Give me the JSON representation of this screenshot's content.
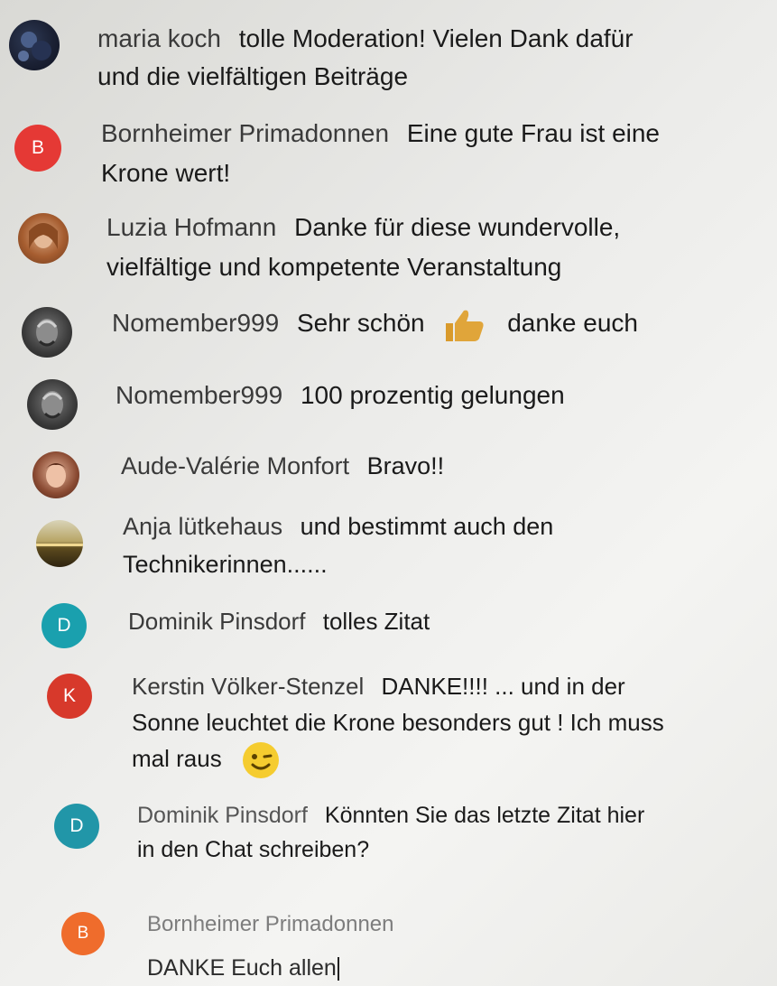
{
  "messages": [
    {
      "author": "maria koch",
      "text": "tolle Moderation! Vielen Dank dafür",
      "text2": "und die vielfältigen Beiträge",
      "avatar": "photo"
    },
    {
      "author": "Bornheimer Primadonnen",
      "text": "Eine gute Frau ist eine",
      "text2": "Krone wert!",
      "avatar_letter": "B",
      "avatar_color": "#e53935"
    },
    {
      "author": "Luzia Hofmann",
      "text": "Danke für diese wundervolle,",
      "text2": "vielfältige und kompetente Veranstaltung",
      "avatar": "photo"
    },
    {
      "author": "Nomember999",
      "text": "Sehr schön",
      "text_after": "danke euch",
      "emoji": "thumbs-up"
    },
    {
      "author": "Nomember999",
      "text": "100 prozentig gelungen"
    },
    {
      "author": "Aude-Valérie Monfort",
      "text": "Bravo!!"
    },
    {
      "author": "Anja lütkehaus",
      "text": "und bestimmt auch den",
      "text2": "Technikerinnen......"
    },
    {
      "author": "Dominik Pinsdorf",
      "text": "tolles Zitat",
      "avatar_letter": "D",
      "avatar_color": "#1aa0ae"
    },
    {
      "author": "Kerstin Völker-Stenzel",
      "text": "DANKE!!!! ... und in der",
      "text2": "Sonne leuchtet die Krone besonders gut ! Ich muss",
      "text3": "mal raus",
      "emoji": "winking-face",
      "avatar_letter": "K",
      "avatar_color": "#d7392b"
    },
    {
      "author": "Dominik Pinsdorf",
      "text": "Könnten Sie das letzte Zitat hier",
      "text2": "in den Chat schreiben?",
      "avatar_letter": "D",
      "avatar_color": "#2196a8"
    }
  ],
  "input": {
    "author": "Bornheimer Primadonnen",
    "avatar_letter": "B",
    "avatar_color": "#ef6c2c",
    "value": "DANKE Euch allen"
  }
}
